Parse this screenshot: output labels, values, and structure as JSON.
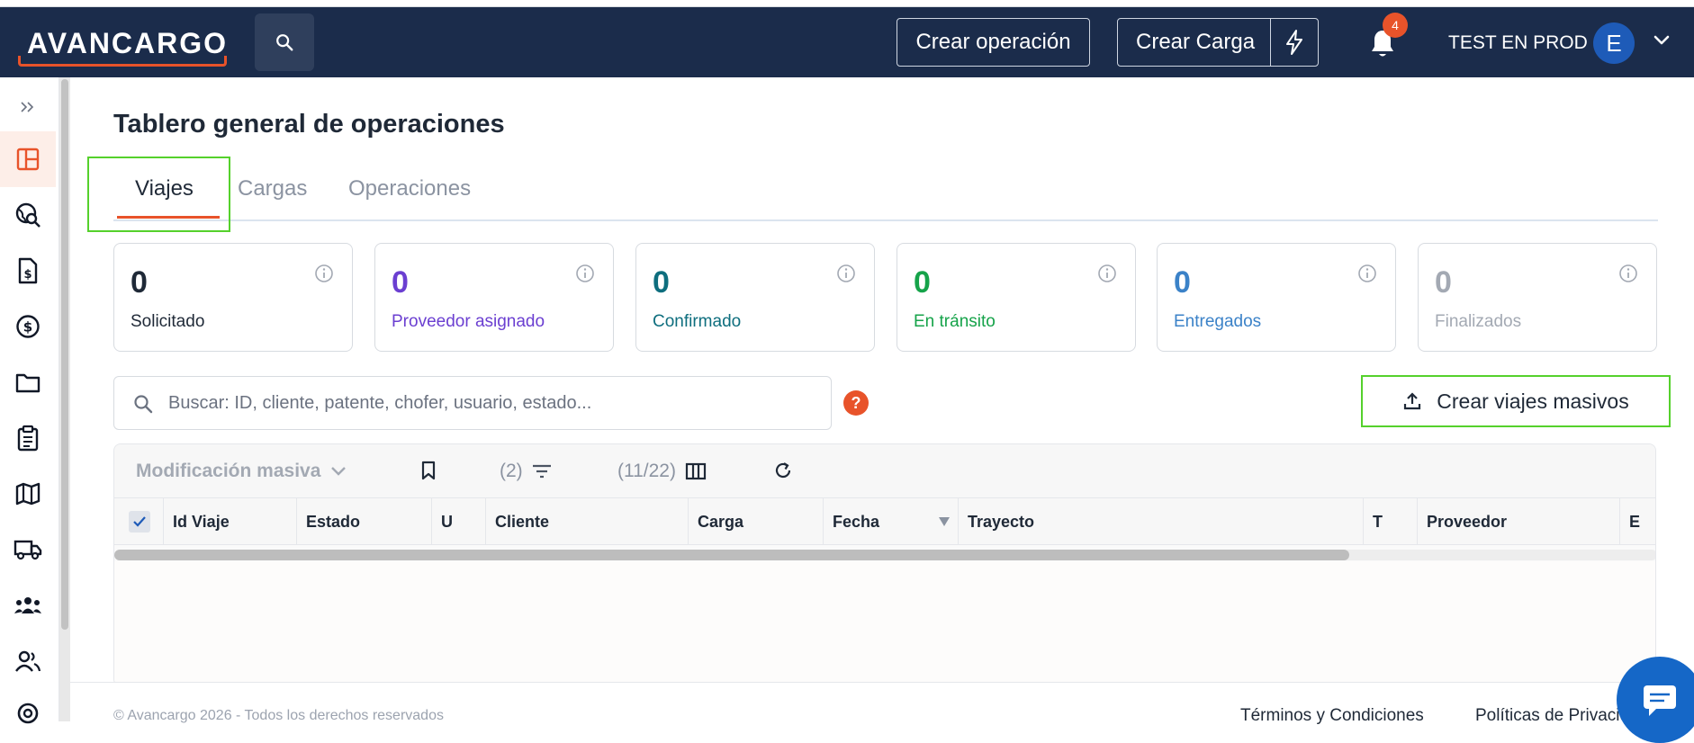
{
  "header": {
    "logo_text": "AVANCARGO",
    "create_operation_label": "Crear operación",
    "create_load_label": "Crear Carga",
    "notification_count": "4",
    "user_name": "TEST EN PROD",
    "avatar_initial": "E"
  },
  "sidebar": {
    "items": [
      "expand-icon",
      "dashboard-icon",
      "global-search-icon",
      "invoice-icon",
      "dollar-icon",
      "folder-icon",
      "clipboard-icon",
      "map-icon",
      "truck-icon",
      "team-icon",
      "users-icon",
      "settings-icon"
    ]
  },
  "main": {
    "title": "Tablero general de operaciones",
    "tabs": [
      {
        "label": "Viajes"
      },
      {
        "label": "Cargas"
      },
      {
        "label": "Operaciones"
      }
    ]
  },
  "cards": [
    {
      "value": "0",
      "label": "Solicitado",
      "color": "#1f2937"
    },
    {
      "value": "0",
      "label": "Proveedor asignado",
      "color": "#6b3fd1"
    },
    {
      "value": "0",
      "label": "Confirmado",
      "color": "#0e6e7e"
    },
    {
      "value": "0",
      "label": "En tránsito",
      "color": "#16a34a"
    },
    {
      "value": "0",
      "label": "Entregados",
      "color": "#3b82c8"
    },
    {
      "value": "0",
      "label": "Finalizados",
      "color": "#a3a9b3"
    }
  ],
  "search": {
    "placeholder": "Buscar: ID, cliente, patente, chofer, usuario, estado...",
    "help_label": "?"
  },
  "bulk_button_label": "Crear viajes masivos",
  "grid": {
    "bulk_edit_label": "Modificación masiva",
    "filter_count": "(2)",
    "columns_count": "(11/22)",
    "columns": [
      "Id Viaje",
      "Estado",
      "U",
      "Cliente",
      "Carga",
      "Fecha",
      "Trayecto",
      "T",
      "Proveedor",
      "E"
    ]
  },
  "footer": {
    "copyright": "© Avancargo 2026 - Todos los derechos reservados",
    "terms": "Términos y Condiciones",
    "privacy": "Políticas de Privacidad"
  },
  "colors": {
    "brand_navy": "#1b2c4b",
    "accent_orange": "#e8532a",
    "highlight_green": "#55d12c"
  }
}
